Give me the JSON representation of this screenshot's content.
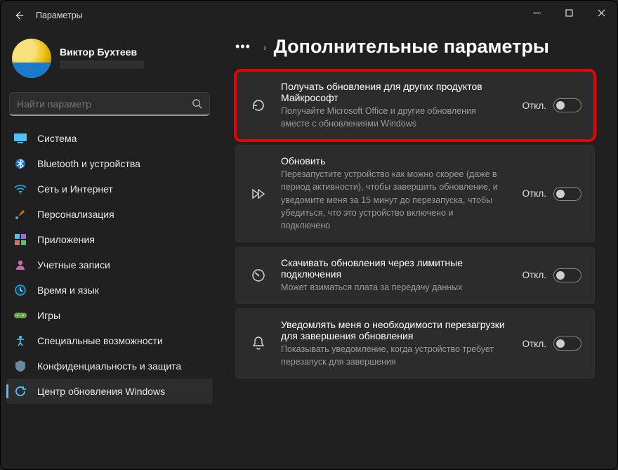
{
  "window": {
    "title": "Параметры"
  },
  "profile": {
    "name": "Виктор Бухтеев"
  },
  "search": {
    "placeholder": "Найти параметр"
  },
  "sidebar": {
    "items": [
      {
        "label": "Система",
        "icon": "monitor-icon"
      },
      {
        "label": "Bluetooth и устройства",
        "icon": "bluetooth-icon"
      },
      {
        "label": "Сеть и Интернет",
        "icon": "wifi-icon"
      },
      {
        "label": "Персонализация",
        "icon": "brush-icon"
      },
      {
        "label": "Приложения",
        "icon": "apps-icon"
      },
      {
        "label": "Учетные записи",
        "icon": "person-icon"
      },
      {
        "label": "Время и язык",
        "icon": "globe-clock-icon"
      },
      {
        "label": "Игры",
        "icon": "gamepad-icon"
      },
      {
        "label": "Специальные возможности",
        "icon": "accessibility-icon"
      },
      {
        "label": "Конфиденциальность и защита",
        "icon": "shield-icon"
      },
      {
        "label": "Центр обновления Windows",
        "icon": "update-icon",
        "active": true
      }
    ]
  },
  "page": {
    "ellipsis": "•••",
    "title": "Дополнительные параметры"
  },
  "cards": [
    {
      "title": "Получать обновления для других продуктов Майкрософт",
      "desc": "Получайте Microsoft Office и другие обновления вместе с обновлениями Windows",
      "state": "Откл.",
      "icon": "history-icon",
      "highlight": true
    },
    {
      "title": "Обновить",
      "desc": "Перезапустите устройство как можно скорее (даже в период активности), чтобы завершить обновление, и уведомите меня за 15 минут до перезапуска, чтобы убедиться, что это устройство включено и подключено",
      "state": "Откл.",
      "icon": "fast-forward-icon"
    },
    {
      "title": "Скачивать обновления через лимитные подключения",
      "desc": "Может взиматься плата за передачу данных",
      "state": "Откл.",
      "icon": "gauge-icon"
    },
    {
      "title": "Уведомлять меня о необходимости перезагрузки для завершения обновления",
      "desc": "Показывать уведомление, когда устройство требует перезапуск для завершения",
      "state": "Откл.",
      "icon": "bell-icon"
    }
  ]
}
